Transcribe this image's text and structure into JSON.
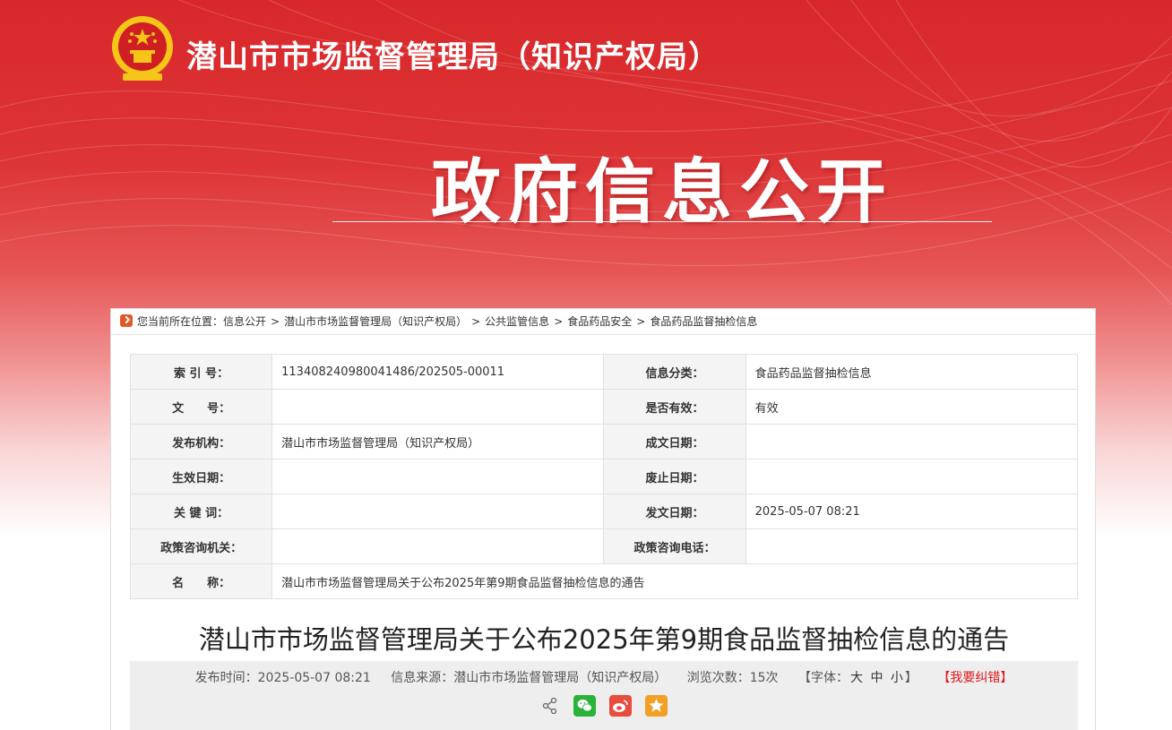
{
  "header": {
    "site_title": "潜山市市场监督管理局（知识产权局）",
    "banner_title": "政府信息公开"
  },
  "breadcrumb": {
    "prefix": "您当前所在位置：",
    "items": [
      "信息公开",
      "潜山市市场监督管理局（知识产权局）",
      "公共监管信息",
      "食品药品安全",
      "食品药品监督抽检信息"
    ],
    "separator": ">"
  },
  "meta": {
    "rows": [
      {
        "k1": "索 引 号：",
        "v1": "113408240980041486/202505-00011",
        "k2": "信息分类：",
        "v2": "食品药品监督抽检信息"
      },
      {
        "k1": "文　　号：",
        "v1": "",
        "k2": "是否有效：",
        "v2": "有效"
      },
      {
        "k1": "发布机构：",
        "v1": "潜山市市场监督管理局（知识产权局）",
        "k2": "成文日期：",
        "v2": ""
      },
      {
        "k1": "生效日期：",
        "v1": "",
        "k2": "废止日期：",
        "v2": ""
      },
      {
        "k1": "关 键 词：",
        "v1": "",
        "k2": "发文日期：",
        "v2": "2025-05-07 08:21"
      },
      {
        "k1": "政策咨询机关：",
        "v1": "",
        "k2": "政策咨询电话：",
        "v2": ""
      }
    ],
    "name_label": "名　　称：",
    "name_value": "潜山市市场监督管理局关于公布2025年第9期食品监督抽检信息的通告"
  },
  "article": {
    "title": "潜山市市场监督管理局关于公布2025年第9期食品监督抽检信息的通告",
    "publish_time": "发布时间：2025-05-07 08:21",
    "source": "信息来源：潜山市市场监督管理局（知识产权局）",
    "views": "浏览次数：15次",
    "font_label_open": "【字体：",
    "font_large": "大",
    "font_medium": "中",
    "font_small": "小",
    "font_label_close": "】",
    "error_report": "【我要纠错】"
  },
  "share": {
    "icons": [
      "share-icon",
      "wechat-icon",
      "weibo-icon",
      "favorite-icon"
    ]
  },
  "colors": {
    "header_red": "#d8282b",
    "accent_red": "#e0191b",
    "wechat": "#2bb238",
    "weibo": "#e94b3c",
    "favorite": "#f29f26"
  }
}
